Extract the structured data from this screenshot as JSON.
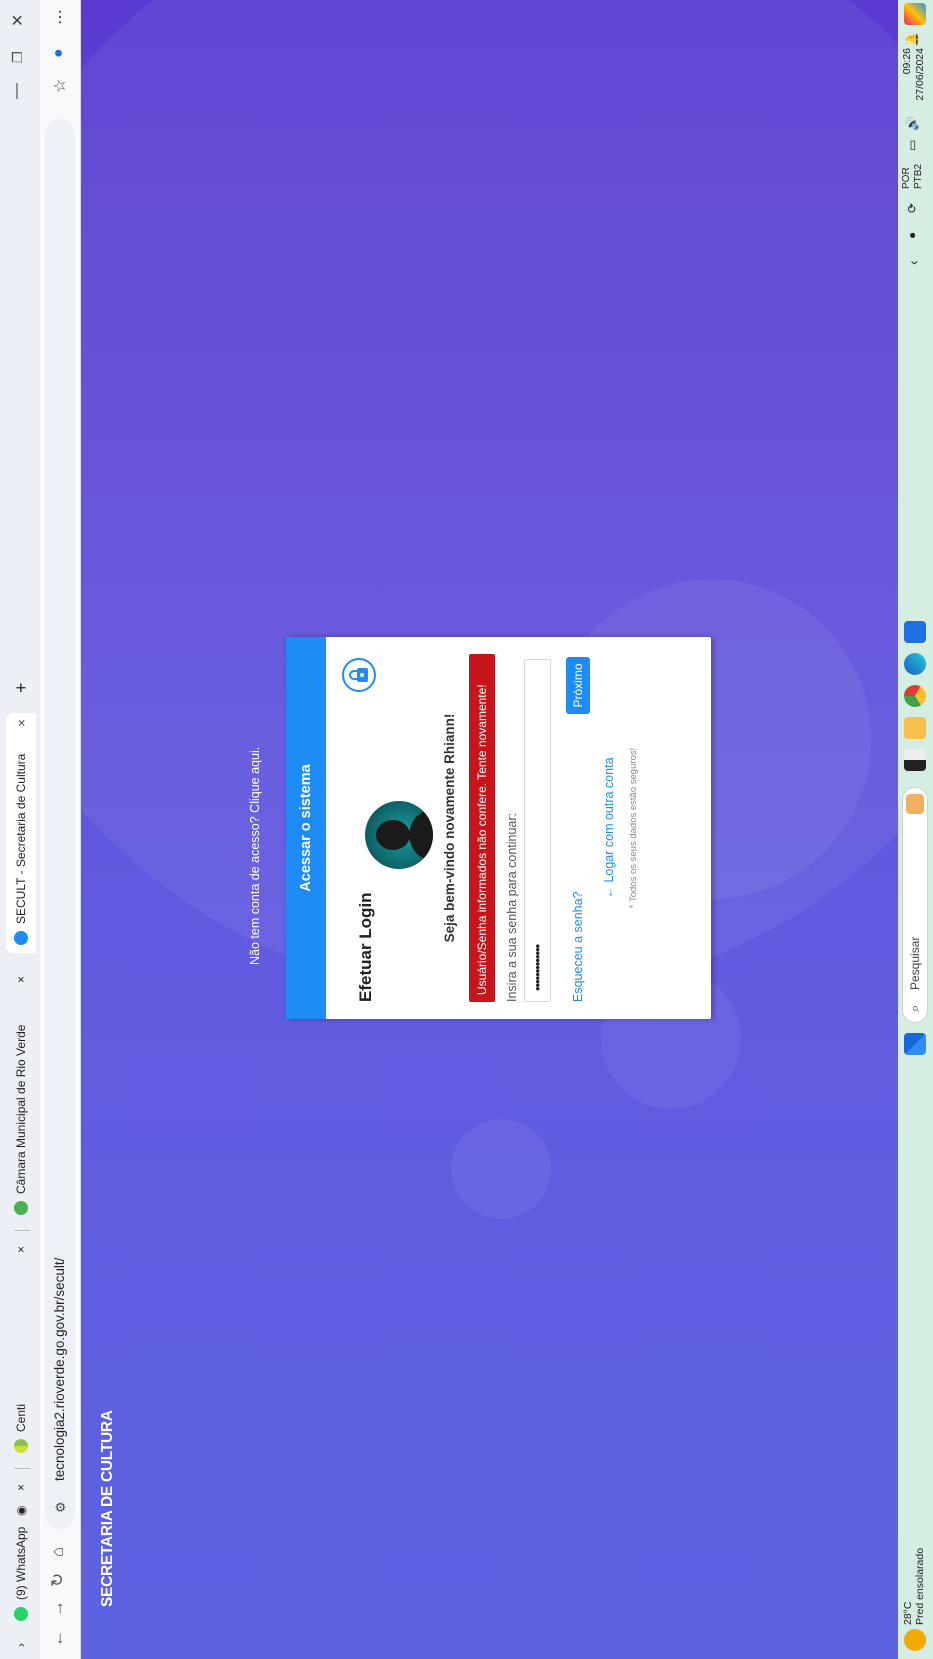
{
  "browser": {
    "tabs": [
      {
        "label": "(9) WhatsApp",
        "icon": "whatsapp-icon"
      },
      {
        "label": "Centi",
        "icon": "centi-icon"
      },
      {
        "label": "Câmara Municipal de Rio Verde",
        "icon": "camara-icon"
      },
      {
        "label": "SECULT - Secretaria de Cultura",
        "icon": "secult-icon",
        "active": true
      }
    ],
    "url": "tecnologia2.rioverde.go.gov.br/secult/"
  },
  "page": {
    "brand": "SECRETARIA DE CULTURA",
    "register_link": "Não tem conta de acesso? Clique aqui."
  },
  "login": {
    "header": "Acessar o sistema",
    "title": "Efetuar Login",
    "welcome": "Seja bem-vindo novamente Rhiann!",
    "error": "Usuário/Senha informados não confere. Tente novamente!",
    "prompt": "Insira a sua senha para continuar:",
    "password_mask": "•••••••••••••",
    "forgot": "Esqueceu a senha?",
    "next": "Próximo",
    "other_account": "← Logar com outra conta",
    "secure_note": "* Todos os seus dados estão seguros!"
  },
  "taskbar": {
    "weather_temp": "28°C",
    "weather_desc": "Pred ensolarado",
    "search_placeholder": "Pesquisar",
    "lang": "POR",
    "layout": "PTB2",
    "time": "09:26",
    "date": "27/06/2024"
  },
  "colors": {
    "accent": "#1f8cf5",
    "error": "#c6161b",
    "background": "#6155dc"
  }
}
